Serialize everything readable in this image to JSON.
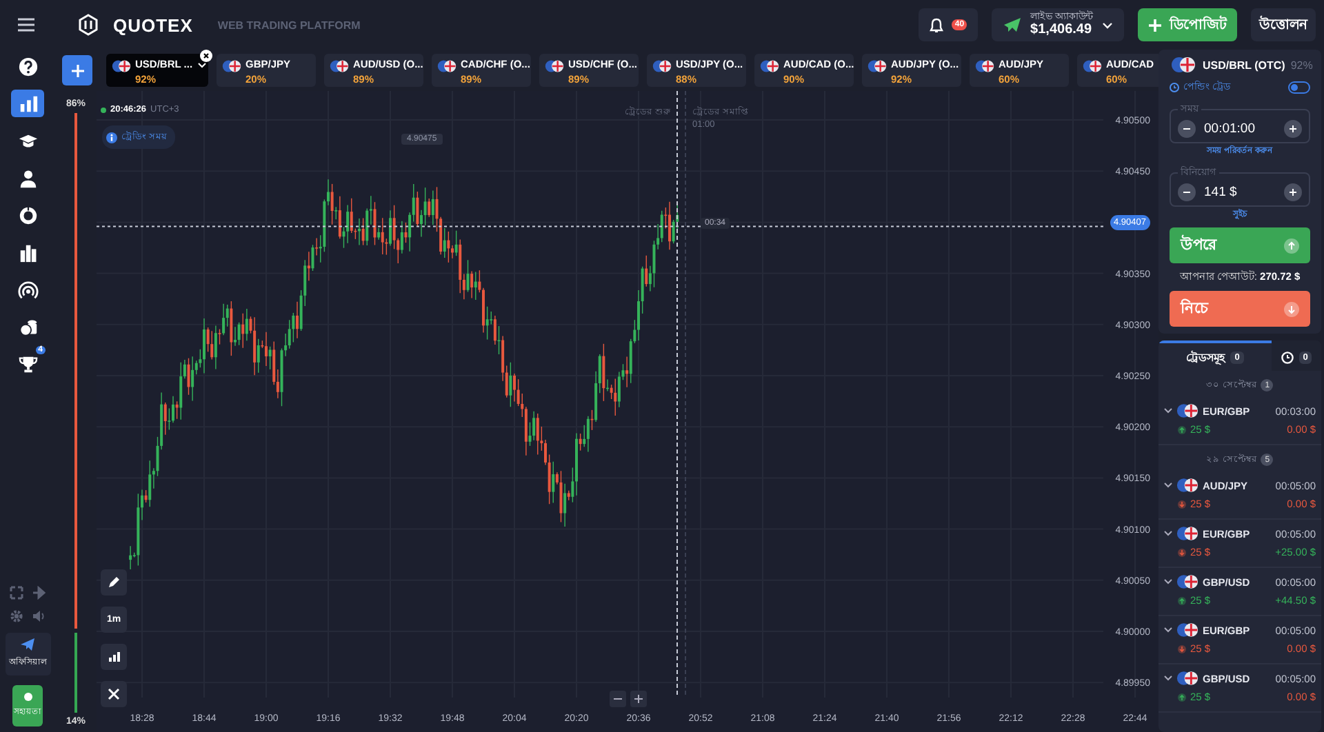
{
  "header": {
    "logo": "QUOTEX",
    "subtitle": "WEB TRADING PLATFORM",
    "notification_count": "40",
    "account_label": "লাইভ অ্যাকাউন্ট",
    "balance": "$1,406.49",
    "deposit": "ডিপোজিট",
    "withdraw": "উত্তোলন"
  },
  "sidebar": {
    "items": [
      {
        "kind": "help",
        "selected": false
      },
      {
        "kind": "chart",
        "selected": true
      },
      {
        "kind": "education",
        "selected": false
      },
      {
        "kind": "profile",
        "selected": false
      },
      {
        "kind": "analytics",
        "selected": false
      },
      {
        "kind": "market",
        "selected": false
      },
      {
        "kind": "signals",
        "selected": false
      },
      {
        "kind": "coins",
        "selected": false
      },
      {
        "kind": "trophy",
        "selected": false,
        "badge": "4"
      }
    ],
    "telegram_label": "অফিসিয়াল",
    "support_label": "সহায়তা"
  },
  "sentiment": {
    "up": "86%",
    "down": "14%",
    "level": 0.86
  },
  "assets": [
    {
      "name": "USD/BRL ...",
      "payout": "92%",
      "selected": true
    },
    {
      "name": "GBP/JPY",
      "payout": "20%",
      "selected": false
    },
    {
      "name": "AUD/USD (O...",
      "payout": "89%",
      "selected": false
    },
    {
      "name": "CAD/CHF (O...",
      "payout": "89%",
      "selected": false
    },
    {
      "name": "USD/CHF (O...",
      "payout": "89%",
      "selected": false
    },
    {
      "name": "USD/JPY (O...",
      "payout": "88%",
      "selected": false
    },
    {
      "name": "AUD/CAD (O...",
      "payout": "90%",
      "selected": false
    },
    {
      "name": "AUD/JPY (O...",
      "payout": "92%",
      "selected": false
    },
    {
      "name": "AUD/JPY",
      "payout": "60%",
      "selected": false
    },
    {
      "name": "AUD/CAD",
      "payout": "60%",
      "selected": false
    }
  ],
  "chart": {
    "clock": "20:46:26",
    "timezone": "UTC+3",
    "info": "ট্রেডিং সময়",
    "trade_start": "ট্রেডের শুরু",
    "trade_end": "ট্রেডের সমাপ্তি",
    "trade_end_time": "01:00",
    "high_label": "4.90475",
    "timer": "00:34",
    "current_price": "4.90407",
    "timeframe": "1m",
    "price_axis": [
      "4.90500",
      "4.90450",
      "4.90350",
      "4.90300",
      "4.90250",
      "4.90200",
      "4.90150",
      "4.90100",
      "4.90050",
      "4.90000",
      "4.89950"
    ],
    "time_axis": [
      "18:28",
      "18:44",
      "19:00",
      "19:16",
      "19:32",
      "19:48",
      "20:04",
      "20:20",
      "20:36",
      "20:52",
      "21:08",
      "21:24",
      "21:40",
      "21:56",
      "22:12",
      "22:28",
      "22:44"
    ]
  },
  "trade_panel": {
    "asset": "USD/BRL (OTC)",
    "payout": "92%",
    "pending_label": "পেন্ডিং ট্রেড",
    "pending_on": false,
    "time_label": "সময়",
    "time": "00:01:00",
    "time_link": "সময় পরিবর্তন করুন",
    "amount_label": "বিনিয়োগ",
    "amount": "141 $",
    "amount_link": "সুইচ",
    "up": "উপরে",
    "payout_text": "আপনার পেআউট: **270.72 $**",
    "down": "নিচে"
  },
  "trades": {
    "tab_label": "ট্রেডসমূহ",
    "open_count": "0",
    "history_count": "0",
    "groups": [
      {
        "date": "৩০ সেপ্টেম্বর",
        "count": "1",
        "trades": [
          {
            "pair": "EUR/GBP",
            "time": "00:03:00",
            "amount": "25 $",
            "direction_up": true,
            "result": "0.00 $",
            "won": false
          }
        ]
      },
      {
        "date": "২৯ সেপ্টেম্বর",
        "count": "5",
        "trades": [
          {
            "pair": "AUD/JPY",
            "time": "00:05:00",
            "amount": "25 $",
            "direction_up": false,
            "result": "0.00 $",
            "won": false
          },
          {
            "pair": "EUR/GBP",
            "time": "00:05:00",
            "amount": "25 $",
            "direction_up": false,
            "result": "+25.00 $",
            "won": true
          },
          {
            "pair": "GBP/USD",
            "time": "00:05:00",
            "amount": "25 $",
            "direction_up": true,
            "result": "+44.50 $",
            "won": true
          },
          {
            "pair": "EUR/GBP",
            "time": "00:05:00",
            "amount": "25 $",
            "direction_up": false,
            "result": "0.00 $",
            "won": false
          },
          {
            "pair": "GBP/USD",
            "time": "00:05:00",
            "amount": "25 $",
            "direction_up": true,
            "result": "0.00 $",
            "won": false
          }
        ]
      }
    ]
  }
}
